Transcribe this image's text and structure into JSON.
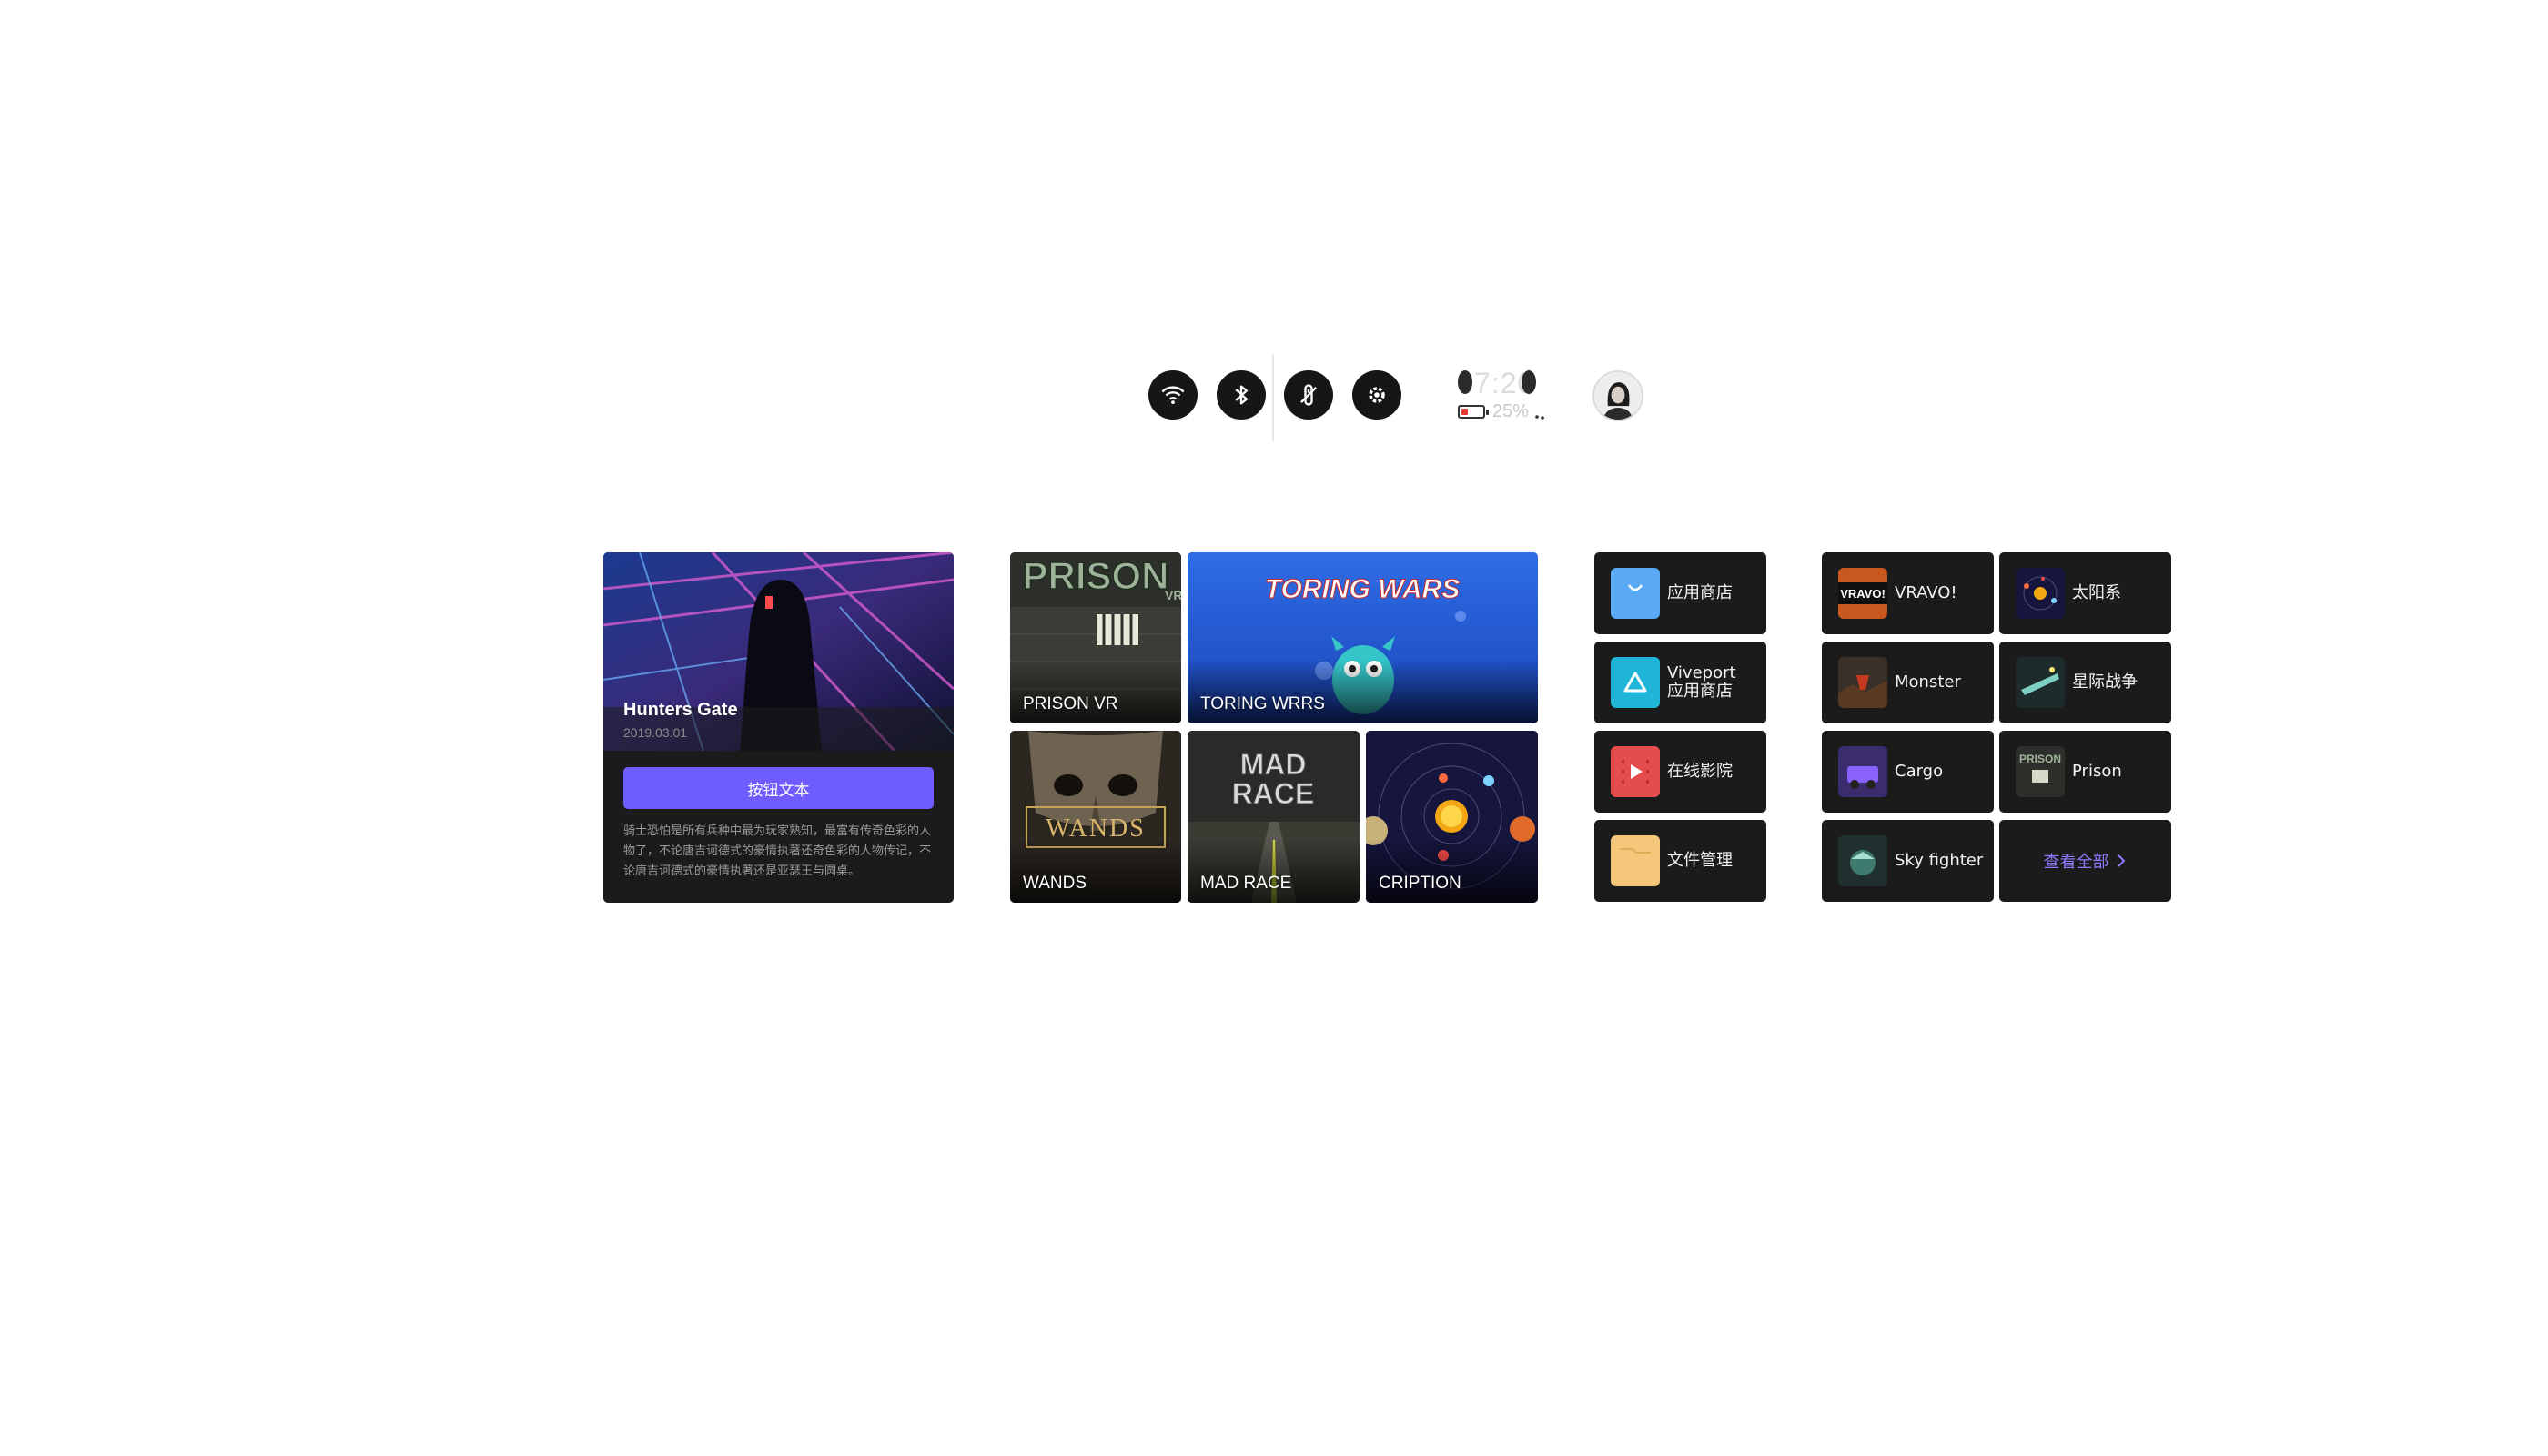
{
  "status_bar": {
    "icons": [
      "wifi-icon",
      "bluetooth-icon",
      "controller-icon",
      "settings-icon"
    ],
    "clock": "7:20",
    "battery_percent": "25%",
    "battery_level": 0.25,
    "avatar": "user-avatar"
  },
  "featured": {
    "title": "Hunters Gate",
    "date": "2019.03.01",
    "button_label": "按钮文本",
    "description": "骑士恐怕是所有兵种中最为玩家熟知，最富有传奇色彩的人物了，不论唐吉诃德式的豪情执著还奇色彩的人物传记，不论唐吉诃德式的豪情执著还是亚瑟王与圆桌。",
    "accent": "#6f5cff"
  },
  "games": [
    {
      "label": "PRISON VR",
      "art": "prison"
    },
    {
      "label": "TORING WRRS",
      "art": "toring",
      "art_title": "TORING WARS"
    },
    {
      "label": "WANDS",
      "art": "wands",
      "art_title": "WANDS"
    },
    {
      "label": "MAD RACE",
      "art": "madrace",
      "art_title_line1": "MAD",
      "art_title_line2": "RACE"
    },
    {
      "label": "CRIPTION",
      "art": "solar"
    }
  ],
  "apps": [
    {
      "label": "应用商店",
      "icon": "app-store-icon",
      "color": "#5aa9f5"
    },
    {
      "label_line1": "Viveport",
      "label_line2": "应用商店",
      "icon": "viveport-icon",
      "color": "#1fb6d8"
    },
    {
      "label": "在线影院",
      "icon": "cinema-icon",
      "color": "#e54d4d"
    },
    {
      "label": "文件管理",
      "icon": "folder-icon",
      "color": "#f5c77a"
    }
  ],
  "recent": [
    {
      "label": "VRAVO!",
      "thumb": "vravo"
    },
    {
      "label": "太阳系",
      "thumb": "solar"
    },
    {
      "label": "Monster",
      "thumb": "monster"
    },
    {
      "label": "星际战争",
      "thumb": "starwar"
    },
    {
      "label": "Cargo",
      "thumb": "cargo"
    },
    {
      "label": "Prison",
      "thumb": "prison"
    },
    {
      "label": "Sky fighter",
      "thumb": "skyfighter"
    }
  ],
  "view_all_label": "查看全部",
  "game_art_text": {
    "prison_title": "PRISON",
    "prison_sub": "VR",
    "vravo_thumb": "VRAVO!",
    "prison_thumb": "PRISON"
  }
}
